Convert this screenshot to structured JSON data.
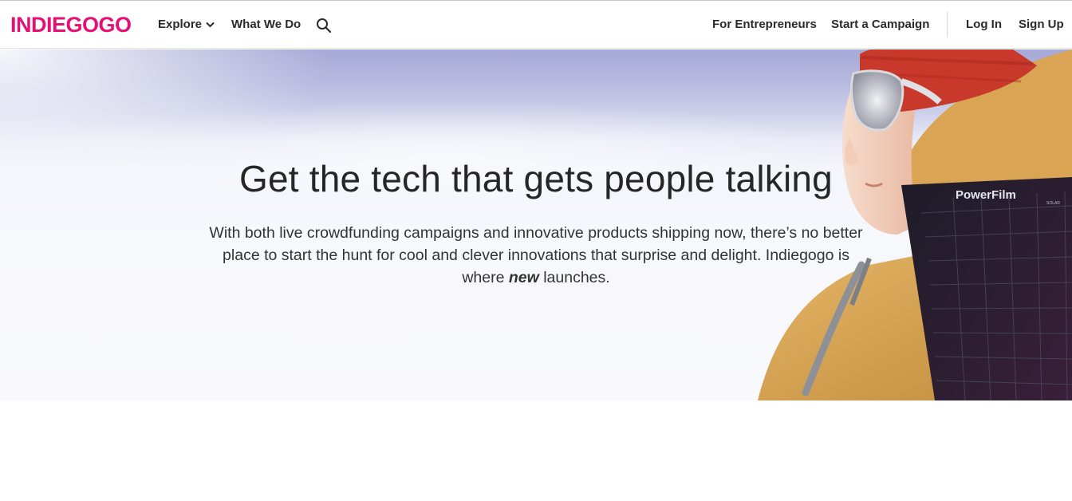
{
  "nav": {
    "logo": "INDIEGOGO",
    "explore": "Explore",
    "what_we_do": "What We Do",
    "for_entrepreneurs": "For Entrepreneurs",
    "start_campaign": "Start a Campaign",
    "log_in": "Log In",
    "sign_up": "Sign Up"
  },
  "hero": {
    "title": "Get the tech that gets people talking",
    "subtitle_before": "With both live crowdfunding campaigns and innovative products shipping now, there’s no better place to start the hunt for cool and clever innovations that surprise and delight. Indiegogo is where ",
    "subtitle_emphasis": "new",
    "subtitle_after": " launches.",
    "panel_brand": "PowerFilm",
    "panel_brand_sub": "SOLAR"
  },
  "colors": {
    "brand": "#e51075",
    "text": "#2a2a2a"
  },
  "icons": {
    "search": "search-icon",
    "explore_caret": "chevron-down-icon"
  }
}
